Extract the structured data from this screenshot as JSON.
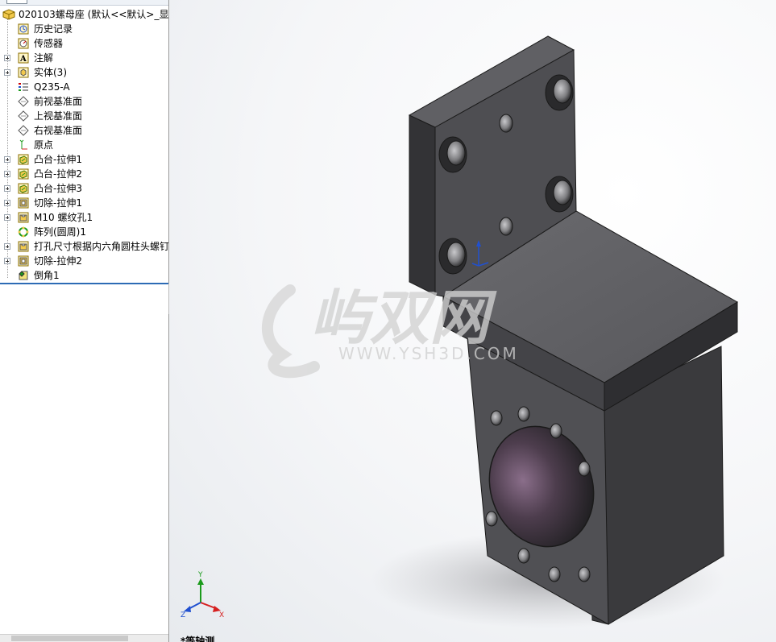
{
  "feature_tree": {
    "root_label": "020103螺母座 (默认<<默认>_显示",
    "items": [
      {
        "label": "历史记录",
        "icon": "history-icon",
        "expandable": false
      },
      {
        "label": "传感器",
        "icon": "sensor-icon",
        "expandable": false
      },
      {
        "label": "注解",
        "icon": "annotation-icon",
        "expandable": true
      },
      {
        "label": "实体(3)",
        "icon": "solid-bodies-icon",
        "expandable": true
      },
      {
        "label": "Q235-A",
        "icon": "material-icon",
        "expandable": false
      },
      {
        "label": "前视基准面",
        "icon": "plane-icon",
        "expandable": false
      },
      {
        "label": "上视基准面",
        "icon": "plane-icon",
        "expandable": false
      },
      {
        "label": "右视基准面",
        "icon": "plane-icon",
        "expandable": false
      },
      {
        "label": "原点",
        "icon": "origin-icon",
        "expandable": false
      },
      {
        "label": "凸台-拉伸1",
        "icon": "boss-extrude-icon",
        "expandable": true
      },
      {
        "label": "凸台-拉伸2",
        "icon": "boss-extrude-icon",
        "expandable": true
      },
      {
        "label": "凸台-拉伸3",
        "icon": "boss-extrude-icon",
        "expandable": true
      },
      {
        "label": "切除-拉伸1",
        "icon": "cut-extrude-icon",
        "expandable": true
      },
      {
        "label": "M10 螺纹孔1",
        "icon": "hole-wizard-icon",
        "expandable": true
      },
      {
        "label": "阵列(圆周)1",
        "icon": "circular-pattern-icon",
        "expandable": false
      },
      {
        "label": "打孔尺寸根据内六角圆柱头螺钉",
        "icon": "hole-wizard-icon",
        "expandable": true
      },
      {
        "label": "切除-拉伸2",
        "icon": "cut-extrude-icon",
        "expandable": true
      },
      {
        "label": "倒角1",
        "icon": "chamfer-icon",
        "expandable": false
      }
    ]
  },
  "viewport": {
    "view_name": "*等轴测",
    "watermark_main": "屿双网",
    "watermark_url": "WWW.YSH3D.COM",
    "triad": {
      "x": "X",
      "y": "Y",
      "z": "Z"
    }
  },
  "colors": {
    "part_face_light": "#5e5e62",
    "part_face_mid": "#4a4a4e",
    "part_face_dark": "#3a3a3d",
    "selection_blue": "#2d6bb5",
    "axis_x": "#d62020",
    "axis_y": "#1b9a1b",
    "axis_z": "#2050d0"
  }
}
